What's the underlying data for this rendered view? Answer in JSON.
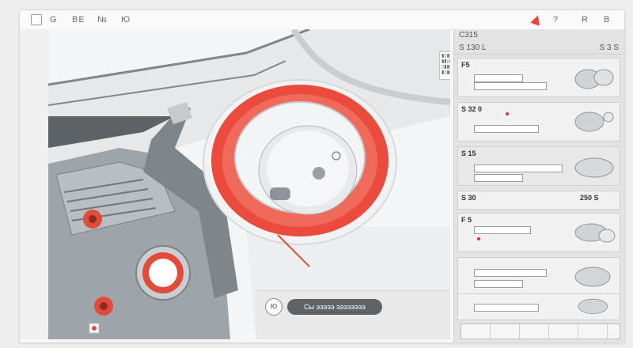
{
  "topbar": {
    "items": [
      "G",
      "ВЕ",
      "№",
      "Ю"
    ],
    "right_items": [
      "?",
      "R",
      "B"
    ]
  },
  "panel": {
    "header": "C315",
    "sub_left": "S 130 L",
    "sub_right": "S 3 S",
    "cards": [
      {
        "label": "F5",
        "right": ""
      },
      {
        "label": "S 32 0",
        "right": ""
      },
      {
        "label": "S 15",
        "right": ""
      },
      {
        "label": "S 30",
        "right": "250 S"
      },
      {
        "label": "F 5",
        "right": ""
      },
      {
        "label": "",
        "right": ""
      },
      {
        "label": "",
        "right": ""
      }
    ]
  },
  "viewport": {
    "pill_label": "Сы эээээ ээээээээ",
    "round_button": "Ю"
  },
  "colors": {
    "accent": "#e8433a",
    "metal": "#9aa1a6",
    "panel_bg": "#e3e3e3"
  }
}
